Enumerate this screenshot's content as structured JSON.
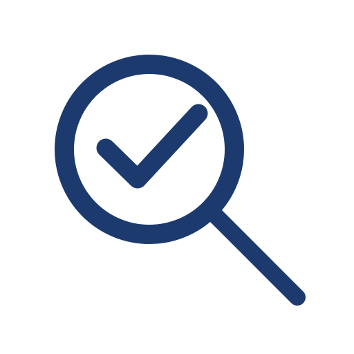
{
  "icon": {
    "name": "search-check-icon",
    "parts": [
      "magnifying-glass-icon",
      "checkmark-icon"
    ],
    "stroke_color": "#1c3a6e",
    "background_color": "#ffffff"
  }
}
